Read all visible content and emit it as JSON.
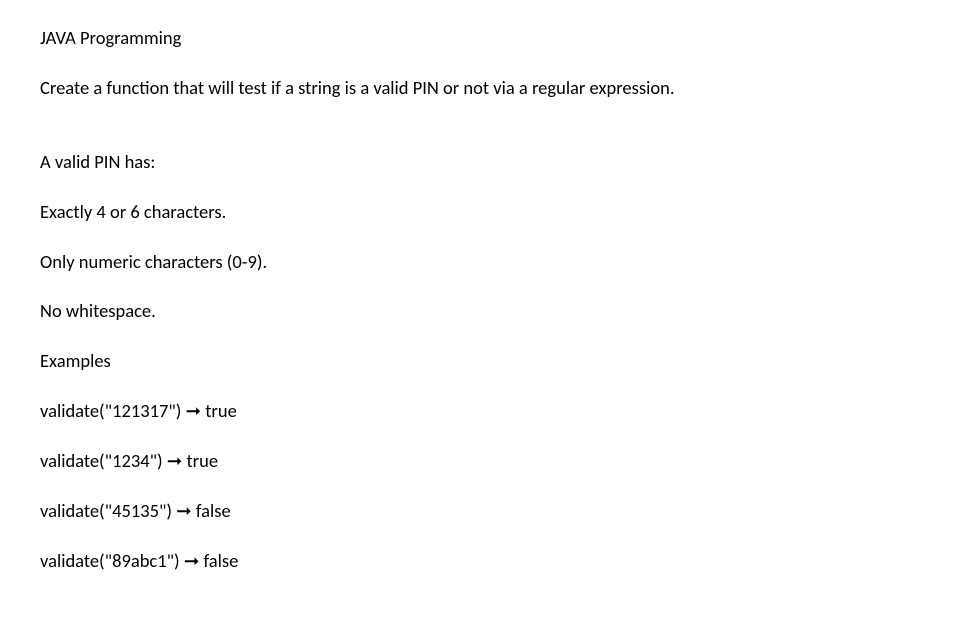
{
  "title": "JAVA Programming",
  "description": "Create a function that will test if a string is a valid PIN or not via a regular expression.",
  "section_heading": "A valid PIN has:",
  "rules": [
    "Exactly 4 or 6 characters.",
    "Only numeric characters (0-9).",
    "No whitespace."
  ],
  "examples_heading": "Examples",
  "examples": [
    "validate(\"121317\") ➞ true",
    "validate(\"1234\") ➞ true",
    "validate(\"45135\") ➞ false",
    "validate(\"89abc1\") ➞ false"
  ]
}
